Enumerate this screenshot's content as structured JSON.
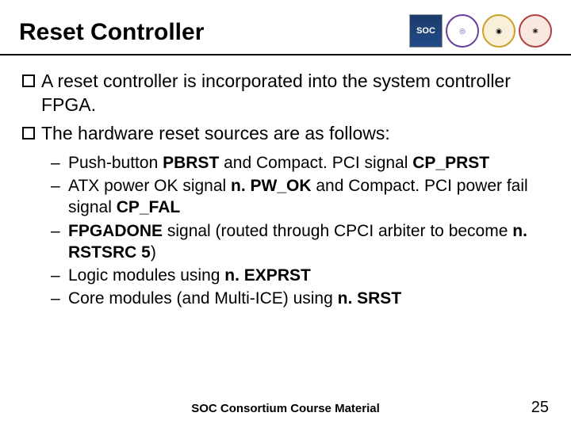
{
  "header": {
    "title": "Reset Controller",
    "logos": [
      "SOC",
      "◎",
      "◉",
      "❀"
    ]
  },
  "bullets": [
    {
      "segments": [
        {
          "t": "A reset controller is incorporated into the system controller FPGA.",
          "b": false
        }
      ]
    },
    {
      "segments": [
        {
          "t": "The hardware reset sources are as follows:",
          "b": false
        }
      ]
    }
  ],
  "subitems": [
    [
      {
        "t": "Push-button ",
        "b": false
      },
      {
        "t": "PBRST",
        "b": true
      },
      {
        "t": " and Compact. PCI signal ",
        "b": false
      },
      {
        "t": "CP_PRST",
        "b": true
      }
    ],
    [
      {
        "t": "ATX power OK signal ",
        "b": false
      },
      {
        "t": "n. PW_OK",
        "b": true
      },
      {
        "t": " and Compact. PCI power fail signal ",
        "b": false
      },
      {
        "t": "CP_FAL",
        "b": true
      }
    ],
    [
      {
        "t": "FPGADONE",
        "b": true
      },
      {
        "t": " signal (routed through CPCI arbiter to become ",
        "b": false
      },
      {
        "t": "n. RSTSRC 5",
        "b": true
      },
      {
        "t": ")",
        "b": false
      }
    ],
    [
      {
        "t": "Logic modules using ",
        "b": false
      },
      {
        "t": "n. EXPRST",
        "b": true
      }
    ],
    [
      {
        "t": "Core modules (and Multi-ICE) using ",
        "b": false
      },
      {
        "t": "n. SRST",
        "b": true
      }
    ]
  ],
  "footer": "SOC Consortium Course Material",
  "page": "25"
}
